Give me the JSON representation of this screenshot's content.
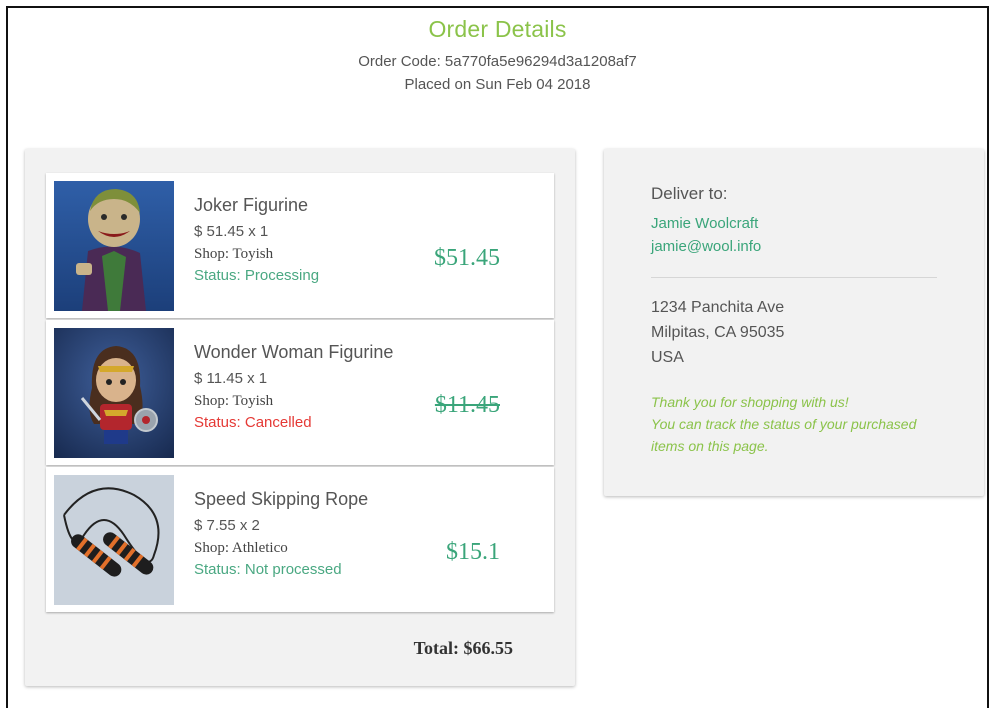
{
  "header": {
    "title": "Order Details",
    "order_code": "Order Code: 5a770fa5e96294d3a1208af7",
    "placed": "Placed on Sun Feb 04 2018"
  },
  "items": [
    {
      "name": "Joker Figurine",
      "unit": "$ 51.45 x 1",
      "shop": "Shop: Toyish",
      "status": "Status: Processing",
      "price": "$51.45",
      "thumb_icon": "joker-figurine-image"
    },
    {
      "name": "Wonder Woman Figurine",
      "unit": "$ 11.45 x 1",
      "shop": "Shop: Toyish",
      "status": "Status: Cancelled",
      "price": "$11.45",
      "thumb_icon": "wonder-woman-figurine-image"
    },
    {
      "name": "Speed Skipping Rope",
      "unit": "$ 7.55 x 2",
      "shop": "Shop: Athletico",
      "status": "Status: Not processed",
      "price": "$15.1",
      "thumb_icon": "skipping-rope-image"
    }
  ],
  "total": "Total: $66.55",
  "delivery": {
    "label": "Deliver to:",
    "name": "Jamie Woolcraft",
    "email": "jamie@wool.info",
    "address": [
      "1234 Panchita Ave",
      "Milpitas, CA 95035",
      "USA"
    ],
    "note": [
      "Thank you for shopping with us!",
      "You can track the status of your purchased",
      "items on this page."
    ]
  },
  "colors": {
    "title": "#8bc34a",
    "price": "#3aa57a",
    "status_ok": "#4aa882",
    "status_cancelled": "#e53935"
  }
}
